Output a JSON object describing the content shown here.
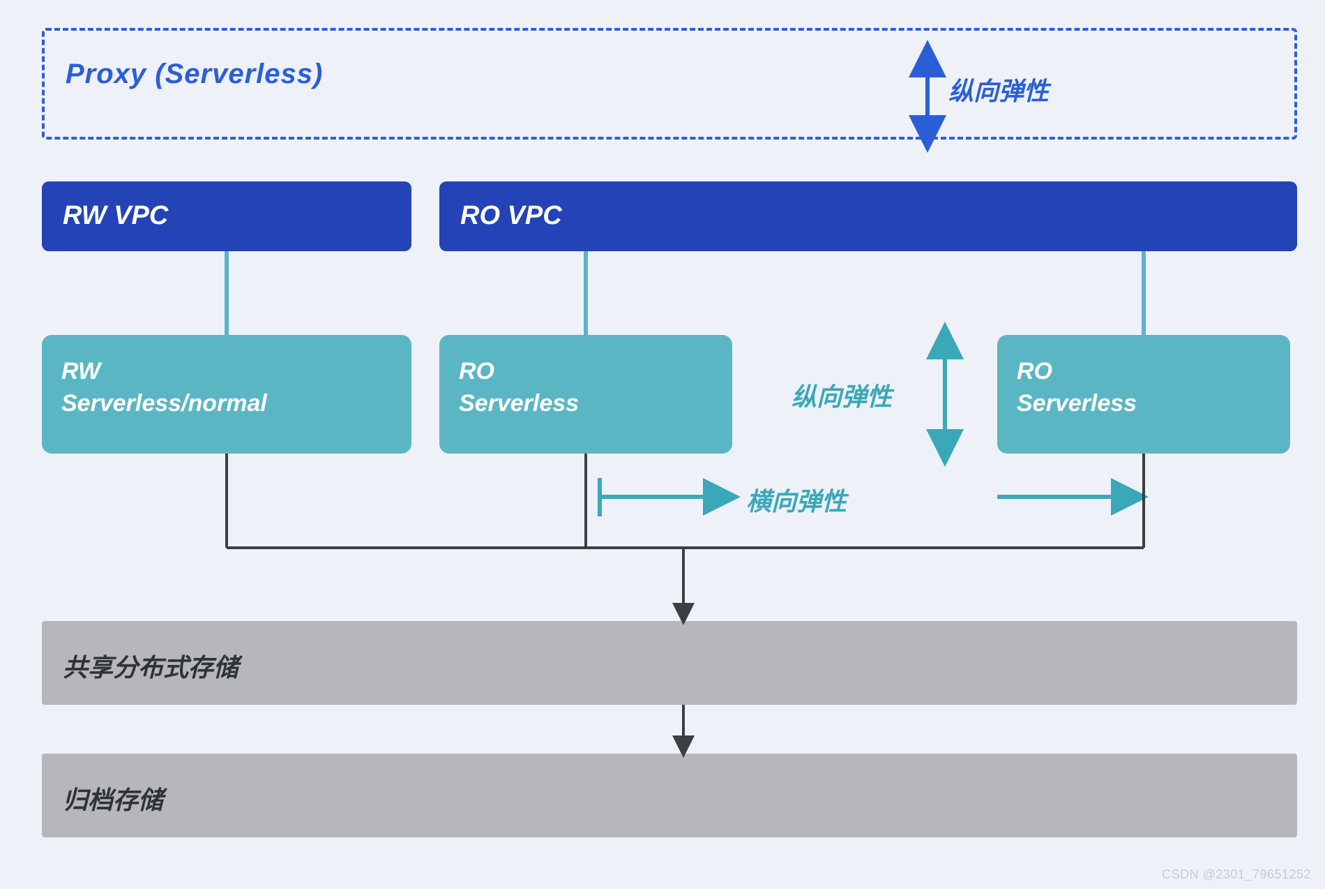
{
  "proxy": {
    "label": "Proxy (Serverless)"
  },
  "vpc": {
    "rw": "RW VPC",
    "ro": "RO VPC"
  },
  "nodes": {
    "rw": "RW\nServerless/normal",
    "ro1": "RO\nServerless",
    "ro2": "RO\nServerless"
  },
  "elastic": {
    "vertical": "纵向弹性",
    "horizontal": "横向弹性"
  },
  "storage": {
    "shared": "共享分布式存储",
    "archive": "归档存储"
  },
  "watermark": "CSDN @2301_79651252",
  "colors": {
    "blue": "#2343b6",
    "dashBlue": "#2b5ed6",
    "teal": "#5bb6c4",
    "tealText": "#3aa8b8",
    "gray": "#b5b7ba",
    "bg": "#eef1f8",
    "line": "#3b3f42"
  }
}
